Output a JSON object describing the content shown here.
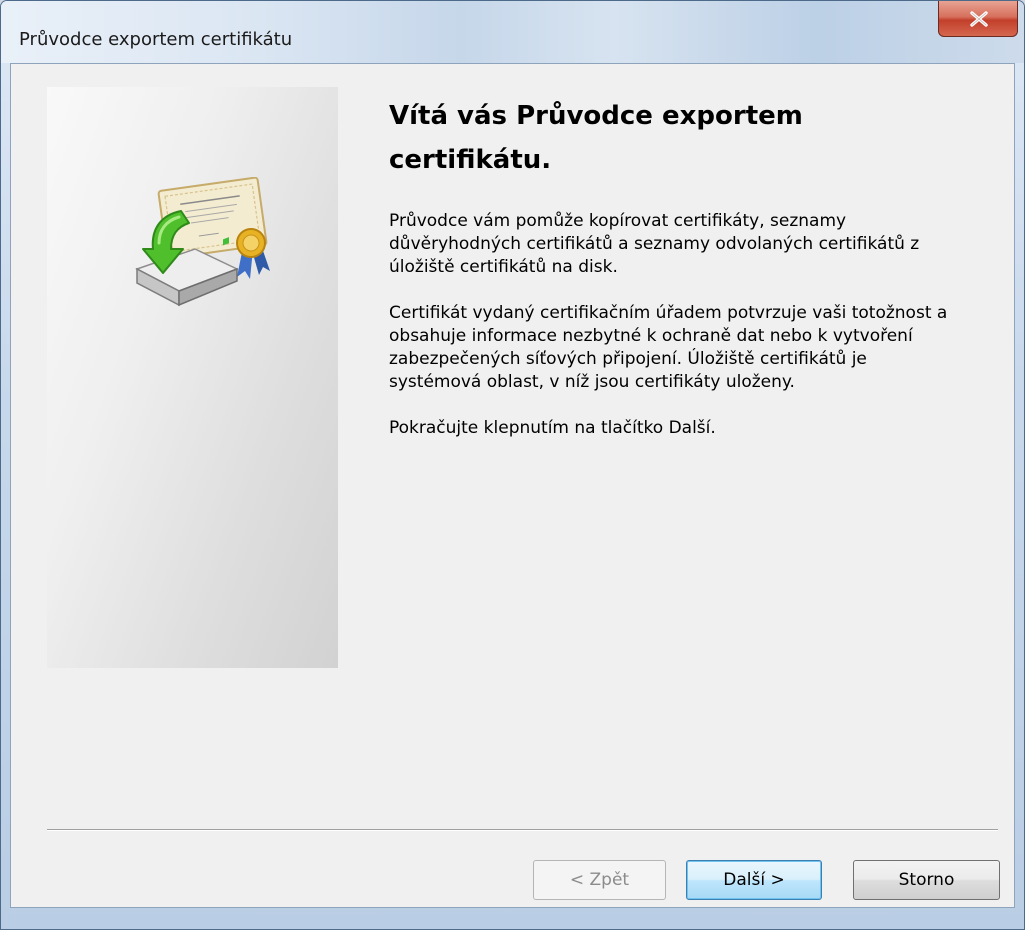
{
  "window": {
    "title": "Průvodce exportem certifikátu",
    "close_symbol": "x",
    "close_icon": "close-icon"
  },
  "side_panel": {
    "icon": "certificate-export-icon"
  },
  "content": {
    "heading": "Vítá vás Průvodce exportem certifikátu.",
    "paragraph1": "Průvodce vám pomůže kopírovat certifikáty, seznamy důvěryhodných certifikátů a seznamy odvolaných certifikátů z úložiště certifikátů na disk.",
    "paragraph2": "Certifikát vydaný certifikačním úřadem potvrzuje vaši totožnost a obsahuje informace nezbytné k ochraně dat nebo k vytvoření zabezpečených síťových připojení. Úložiště certifikátů je systémová oblast, v níž jsou certifikáty uloženy.",
    "paragraph3": "Pokračujte klepnutím na tlačítko Další."
  },
  "buttons": {
    "back": "< Zpět",
    "next": "Další >",
    "cancel": "Storno"
  },
  "colors": {
    "close_button": "#c2402b",
    "default_button_border": "#3c7fb1",
    "client_background": "#f0f0f0"
  }
}
